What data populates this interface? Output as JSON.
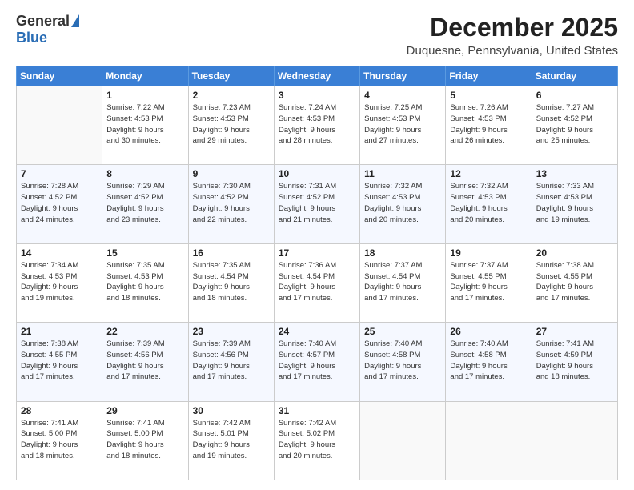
{
  "header": {
    "logo_general": "General",
    "logo_blue": "Blue",
    "month": "December 2025",
    "location": "Duquesne, Pennsylvania, United States"
  },
  "weekdays": [
    "Sunday",
    "Monday",
    "Tuesday",
    "Wednesday",
    "Thursday",
    "Friday",
    "Saturday"
  ],
  "weeks": [
    [
      {
        "day": "",
        "info": ""
      },
      {
        "day": "1",
        "info": "Sunrise: 7:22 AM\nSunset: 4:53 PM\nDaylight: 9 hours\nand 30 minutes."
      },
      {
        "day": "2",
        "info": "Sunrise: 7:23 AM\nSunset: 4:53 PM\nDaylight: 9 hours\nand 29 minutes."
      },
      {
        "day": "3",
        "info": "Sunrise: 7:24 AM\nSunset: 4:53 PM\nDaylight: 9 hours\nand 28 minutes."
      },
      {
        "day": "4",
        "info": "Sunrise: 7:25 AM\nSunset: 4:53 PM\nDaylight: 9 hours\nand 27 minutes."
      },
      {
        "day": "5",
        "info": "Sunrise: 7:26 AM\nSunset: 4:53 PM\nDaylight: 9 hours\nand 26 minutes."
      },
      {
        "day": "6",
        "info": "Sunrise: 7:27 AM\nSunset: 4:52 PM\nDaylight: 9 hours\nand 25 minutes."
      }
    ],
    [
      {
        "day": "7",
        "info": "Sunrise: 7:28 AM\nSunset: 4:52 PM\nDaylight: 9 hours\nand 24 minutes."
      },
      {
        "day": "8",
        "info": "Sunrise: 7:29 AM\nSunset: 4:52 PM\nDaylight: 9 hours\nand 23 minutes."
      },
      {
        "day": "9",
        "info": "Sunrise: 7:30 AM\nSunset: 4:52 PM\nDaylight: 9 hours\nand 22 minutes."
      },
      {
        "day": "10",
        "info": "Sunrise: 7:31 AM\nSunset: 4:52 PM\nDaylight: 9 hours\nand 21 minutes."
      },
      {
        "day": "11",
        "info": "Sunrise: 7:32 AM\nSunset: 4:53 PM\nDaylight: 9 hours\nand 20 minutes."
      },
      {
        "day": "12",
        "info": "Sunrise: 7:32 AM\nSunset: 4:53 PM\nDaylight: 9 hours\nand 20 minutes."
      },
      {
        "day": "13",
        "info": "Sunrise: 7:33 AM\nSunset: 4:53 PM\nDaylight: 9 hours\nand 19 minutes."
      }
    ],
    [
      {
        "day": "14",
        "info": "Sunrise: 7:34 AM\nSunset: 4:53 PM\nDaylight: 9 hours\nand 19 minutes."
      },
      {
        "day": "15",
        "info": "Sunrise: 7:35 AM\nSunset: 4:53 PM\nDaylight: 9 hours\nand 18 minutes."
      },
      {
        "day": "16",
        "info": "Sunrise: 7:35 AM\nSunset: 4:54 PM\nDaylight: 9 hours\nand 18 minutes."
      },
      {
        "day": "17",
        "info": "Sunrise: 7:36 AM\nSunset: 4:54 PM\nDaylight: 9 hours\nand 17 minutes."
      },
      {
        "day": "18",
        "info": "Sunrise: 7:37 AM\nSunset: 4:54 PM\nDaylight: 9 hours\nand 17 minutes."
      },
      {
        "day": "19",
        "info": "Sunrise: 7:37 AM\nSunset: 4:55 PM\nDaylight: 9 hours\nand 17 minutes."
      },
      {
        "day": "20",
        "info": "Sunrise: 7:38 AM\nSunset: 4:55 PM\nDaylight: 9 hours\nand 17 minutes."
      }
    ],
    [
      {
        "day": "21",
        "info": "Sunrise: 7:38 AM\nSunset: 4:55 PM\nDaylight: 9 hours\nand 17 minutes."
      },
      {
        "day": "22",
        "info": "Sunrise: 7:39 AM\nSunset: 4:56 PM\nDaylight: 9 hours\nand 17 minutes."
      },
      {
        "day": "23",
        "info": "Sunrise: 7:39 AM\nSunset: 4:56 PM\nDaylight: 9 hours\nand 17 minutes."
      },
      {
        "day": "24",
        "info": "Sunrise: 7:40 AM\nSunset: 4:57 PM\nDaylight: 9 hours\nand 17 minutes."
      },
      {
        "day": "25",
        "info": "Sunrise: 7:40 AM\nSunset: 4:58 PM\nDaylight: 9 hours\nand 17 minutes."
      },
      {
        "day": "26",
        "info": "Sunrise: 7:40 AM\nSunset: 4:58 PM\nDaylight: 9 hours\nand 17 minutes."
      },
      {
        "day": "27",
        "info": "Sunrise: 7:41 AM\nSunset: 4:59 PM\nDaylight: 9 hours\nand 18 minutes."
      }
    ],
    [
      {
        "day": "28",
        "info": "Sunrise: 7:41 AM\nSunset: 5:00 PM\nDaylight: 9 hours\nand 18 minutes."
      },
      {
        "day": "29",
        "info": "Sunrise: 7:41 AM\nSunset: 5:00 PM\nDaylight: 9 hours\nand 18 minutes."
      },
      {
        "day": "30",
        "info": "Sunrise: 7:42 AM\nSunset: 5:01 PM\nDaylight: 9 hours\nand 19 minutes."
      },
      {
        "day": "31",
        "info": "Sunrise: 7:42 AM\nSunset: 5:02 PM\nDaylight: 9 hours\nand 20 minutes."
      },
      {
        "day": "",
        "info": ""
      },
      {
        "day": "",
        "info": ""
      },
      {
        "day": "",
        "info": ""
      }
    ]
  ]
}
